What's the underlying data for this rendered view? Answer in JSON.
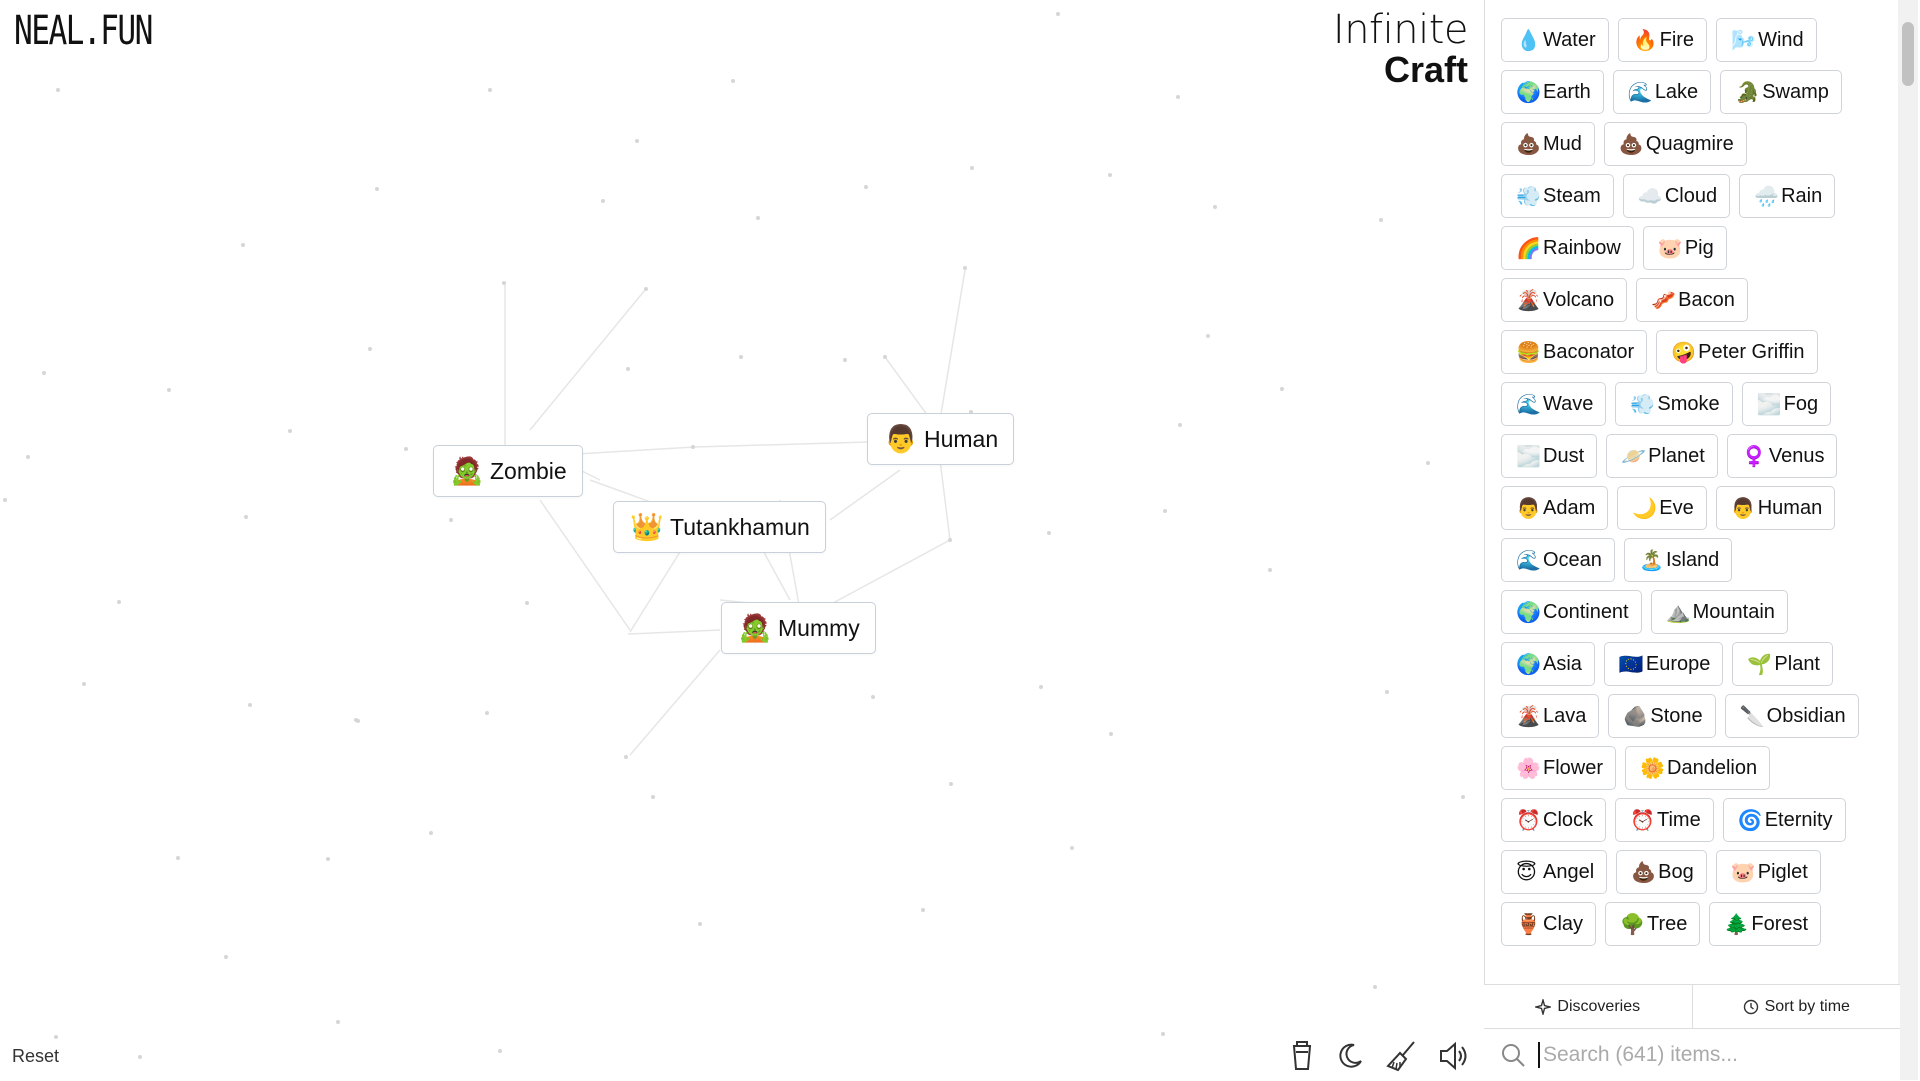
{
  "logo": {
    "neal": "NEAL.FUN",
    "infinite": "Infinite",
    "craft": "Craft"
  },
  "canvas": {
    "instances": [
      {
        "emoji": "🧟",
        "label": "Zombie"
      },
      {
        "emoji": "👨",
        "label": "Human"
      },
      {
        "emoji": "👑",
        "label": "Tutankhamun"
      },
      {
        "emoji": "🧟",
        "label": "Mummy"
      }
    ],
    "reset_label": "Reset"
  },
  "toolbar": [
    "cup-icon",
    "moon-icon",
    "broom-icon",
    "sound-icon"
  ],
  "sidebar": {
    "rows": [
      [
        {
          "e": "💧",
          "l": "Water"
        },
        {
          "e": "🔥",
          "l": "Fire"
        },
        {
          "e": "🌬️",
          "l": "Wind"
        }
      ],
      [
        {
          "e": "🌍",
          "l": "Earth"
        },
        {
          "e": "🌊",
          "l": "Lake"
        },
        {
          "e": "🐊",
          "l": "Swamp"
        }
      ],
      [
        {
          "e": "💩",
          "l": "Mud"
        },
        {
          "e": "💩",
          "l": "Quagmire"
        }
      ],
      [
        {
          "e": "💨",
          "l": "Steam"
        },
        {
          "e": "☁️",
          "l": "Cloud"
        },
        {
          "e": "🌧️",
          "l": "Rain"
        }
      ],
      [
        {
          "e": "🌈",
          "l": "Rainbow"
        },
        {
          "e": "🐷",
          "l": "Pig"
        }
      ],
      [
        {
          "e": "🌋",
          "l": "Volcano"
        },
        {
          "e": "🥓",
          "l": "Bacon"
        }
      ],
      [
        {
          "e": "🍔",
          "l": "Baconator"
        },
        {
          "e": "🤪",
          "l": "Peter Griffin"
        }
      ],
      [
        {
          "e": "🌊",
          "l": "Wave"
        },
        {
          "e": "💨",
          "l": "Smoke"
        },
        {
          "e": "🌫️",
          "l": "Fog"
        }
      ],
      [
        {
          "e": "🌫️",
          "l": "Dust"
        },
        {
          "e": "🪐",
          "l": "Planet"
        },
        {
          "e": "♀️",
          "l": "Venus"
        }
      ],
      [
        {
          "e": "👨",
          "l": "Adam"
        },
        {
          "e": "🌙",
          "l": "Eve"
        },
        {
          "e": "👨",
          "l": "Human"
        }
      ],
      [
        {
          "e": "🌊",
          "l": "Ocean"
        },
        {
          "e": "🏝️",
          "l": "Island"
        }
      ],
      [
        {
          "e": "🌍",
          "l": "Continent"
        },
        {
          "e": "⛰️",
          "l": "Mountain"
        }
      ],
      [
        {
          "e": "🌍",
          "l": "Asia"
        },
        {
          "e": "🇪🇺",
          "l": "Europe"
        },
        {
          "e": "🌱",
          "l": "Plant"
        }
      ],
      [
        {
          "e": "🌋",
          "l": "Lava"
        },
        {
          "e": "🪨",
          "l": "Stone"
        },
        {
          "e": "🔪",
          "l": "Obsidian"
        }
      ],
      [
        {
          "e": "🌸",
          "l": "Flower"
        },
        {
          "e": "🌼",
          "l": "Dandelion"
        }
      ],
      [
        {
          "e": "⏰",
          "l": "Clock"
        },
        {
          "e": "⏰",
          "l": "Time"
        },
        {
          "e": "🌀",
          "l": "Eternity"
        }
      ],
      [
        {
          "e": "😇",
          "l": "Angel"
        },
        {
          "e": "💩",
          "l": "Bog"
        },
        {
          "e": "🐷",
          "l": "Piglet"
        }
      ],
      [
        {
          "e": "🏺",
          "l": "Clay"
        },
        {
          "e": "🌳",
          "l": "Tree"
        },
        {
          "e": "🌲",
          "l": "Forest"
        }
      ]
    ],
    "discoveries_label": "Discoveries",
    "sort_label": "Sort by time",
    "search_placeholder": "Search (641) items..."
  }
}
